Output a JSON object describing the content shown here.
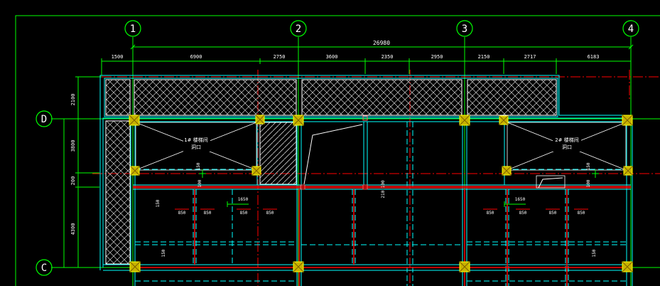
{
  "drawing": {
    "colors": {
      "background": "#000000",
      "axis_bubble": "#00ff00",
      "dimension": "#00ff00",
      "wall_cyan": "#00ffff",
      "beam_red": "#ff0000",
      "column_yellow": "#ffff00",
      "hatch_white": "#ffffff",
      "text_white": "#ffffff"
    },
    "axes_vertical": [
      {
        "label": "1"
      },
      {
        "label": "2"
      },
      {
        "label": "3"
      },
      {
        "label": "4"
      }
    ],
    "axes_horizontal": [
      {
        "label": "D"
      },
      {
        "label": "C"
      }
    ],
    "overall_dimension": "26980",
    "top_dimensions": [
      "1500",
      "6900",
      "2750",
      "3600",
      "2350",
      "2950",
      "2150",
      "2717",
      "6183"
    ],
    "left_dimensions": [
      "2100",
      "3800",
      "200",
      "4300"
    ],
    "rooms": [
      {
        "line1": "1# 楼梯间",
        "line2": "洞口"
      },
      {
        "line1": "2# 楼梯间",
        "line2": "洞口"
      }
    ],
    "beam_labels": [
      "150",
      "150",
      "100",
      "100"
    ],
    "small_dims": [
      "1650",
      "1650",
      "210 100"
    ],
    "rebar_labels": [
      "850",
      "850",
      "850",
      "850",
      "850",
      "850",
      "850",
      "850"
    ],
    "side_labels": [
      "150",
      "150",
      "150"
    ]
  }
}
